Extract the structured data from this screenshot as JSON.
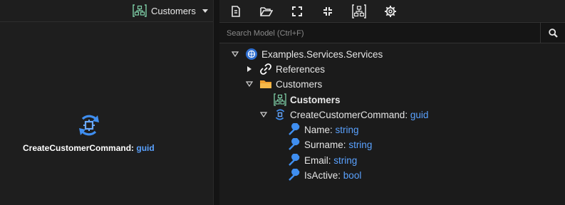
{
  "diagram": {
    "selector_label": "Customers",
    "node": {
      "name": "CreateCustomerCommand",
      "separator": ":",
      "type": "guid"
    }
  },
  "toolbar": {
    "buttons": [
      {
        "name": "new-document-icon"
      },
      {
        "name": "open-folder-icon"
      },
      {
        "name": "expand-icon"
      },
      {
        "name": "collapse-icon"
      },
      {
        "name": "diagram-icon"
      },
      {
        "name": "settings-gear-icon"
      }
    ]
  },
  "search": {
    "placeholder": "Search Model (Ctrl+F)",
    "value": ""
  },
  "tree": {
    "root": "Examples.Services.Services",
    "references": "References",
    "folder": "Customers",
    "diagram_item": "Customers",
    "command": {
      "name": "CreateCustomerCommand",
      "separator": ":",
      "type": "guid"
    },
    "props": [
      {
        "name": "Name",
        "type": "string"
      },
      {
        "name": "Surname",
        "type": "string"
      },
      {
        "name": "Email",
        "type": "string"
      },
      {
        "name": "IsActive",
        "type": "bool"
      }
    ]
  },
  "colors": {
    "accent": "#5aa2ff",
    "folder": "#f0a030",
    "diagram": "#7fd0a8"
  }
}
